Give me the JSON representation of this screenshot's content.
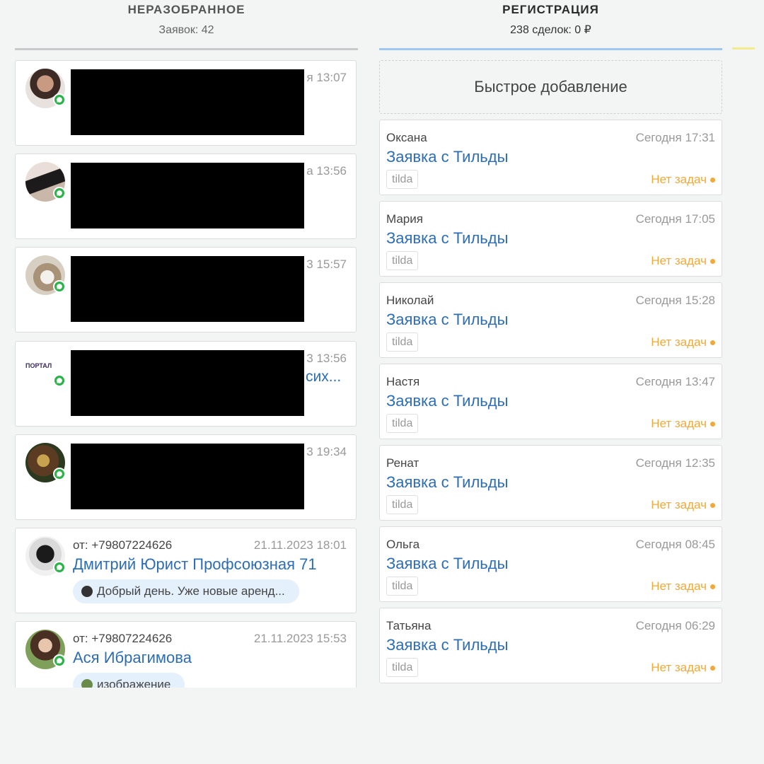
{
  "columns": {
    "unsorted": {
      "title": "НЕРАЗОБРАННОЕ",
      "subtitle": "Заявок: 42"
    },
    "registration": {
      "title": "РЕГИСТРАЦИЯ",
      "subtitle": "238 сделок: 0 ₽",
      "quick_add_label": "Быстрое добавление"
    }
  },
  "unsorted_cards": [
    {
      "time_partial": "я 13:07",
      "name_partial": ""
    },
    {
      "time_partial": "а 13:56",
      "name_partial": ""
    },
    {
      "time_partial": "3 15:57",
      "name_partial": ""
    },
    {
      "time_partial": "3 13:56",
      "name_partial": "сих...",
      "avatar_text": "ПОРТАЛ"
    },
    {
      "time_partial": "3 19:34",
      "name_partial": ""
    },
    {
      "from": "от: +79807224626",
      "time": "21.11.2023 18:01",
      "name": "Дмитрий Юрист Профсоюзная 71",
      "snippet": "Добрый день. Уже новые аренд..."
    },
    {
      "from": "от: +79807224626",
      "time": "21.11.2023 15:53",
      "name": "Ася Ибрагимова",
      "snippet": "изображение"
    }
  ],
  "deals": [
    {
      "contact": "Оксана",
      "time": "Сегодня 17:31",
      "title": "Заявка с Тильды",
      "tag": "tilda",
      "tasks": "Нет задач"
    },
    {
      "contact": "Мария",
      "time": "Сегодня 17:05",
      "title": "Заявка с Тильды",
      "tag": "tilda",
      "tasks": "Нет задач"
    },
    {
      "contact": "Николай",
      "time": "Сегодня 15:28",
      "title": "Заявка с Тильды",
      "tag": "tilda",
      "tasks": "Нет задач"
    },
    {
      "contact": "Настя",
      "time": "Сегодня 13:47",
      "title": "Заявка с Тильды",
      "tag": "tilda",
      "tasks": "Нет задач"
    },
    {
      "contact": "Ренат",
      "time": "Сегодня 12:35",
      "title": "Заявка с Тильды",
      "tag": "tilda",
      "tasks": "Нет задач"
    },
    {
      "contact": "Ольга",
      "time": "Сегодня 08:45",
      "title": "Заявка с Тильды",
      "tag": "tilda",
      "tasks": "Нет задач"
    },
    {
      "contact": "Татьяна",
      "time": "Сегодня 06:29",
      "title": "Заявка с Тильды",
      "tag": "tilda",
      "tasks": "Нет задач"
    }
  ],
  "colors": {
    "link_blue": "#2d6db5",
    "task_orange": "#f0a93a",
    "whatsapp_green": "#2bb34a",
    "rule_blue": "#9fc7ef",
    "rule_gray": "#c7c9cb"
  },
  "icons": {
    "messenger": "whatsapp-icon"
  }
}
